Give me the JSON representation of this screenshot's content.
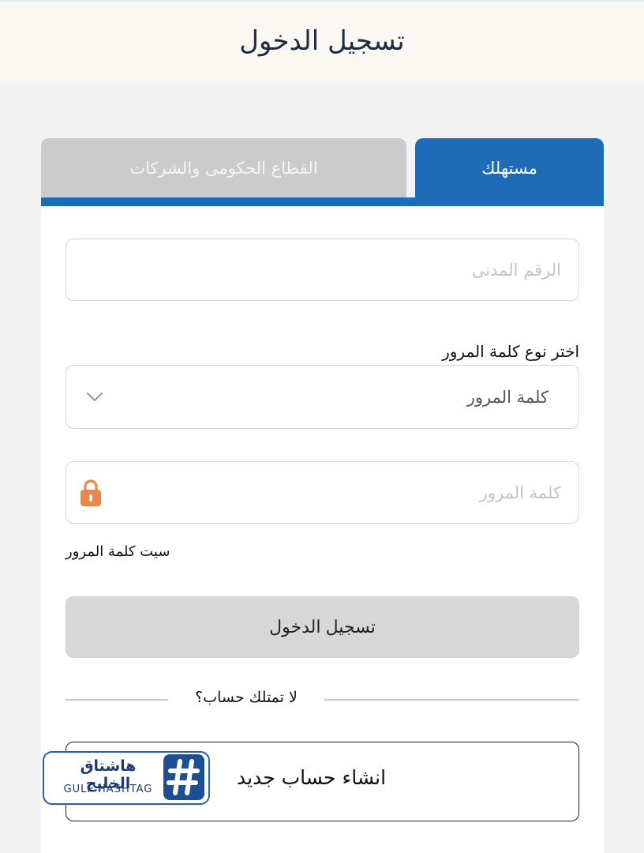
{
  "header": {
    "title": "تسجيل الدخول"
  },
  "tabs": [
    {
      "label": "مستهلك",
      "active": true
    },
    {
      "label": "القطاع الحكومى والشركات",
      "active": false
    }
  ],
  "form": {
    "civil_id_placeholder": "الرقم المدنى",
    "password_type_label": "اختر نوع كلمة المرور",
    "password_type_selected": "كلمة المرور",
    "password_placeholder": "كلمة المرور",
    "forgot_password": "سيت كلمة المرور",
    "login_button": "تسجيل الدخول",
    "no_account_text": "لا تمتلك حساب؟",
    "create_account_button": "انشاء حساب جديد"
  },
  "watermark": {
    "arabic": "هاشتاق الخليج",
    "latin": "GULF HASHTAG"
  },
  "icons": {
    "lock": "lock-icon",
    "dropdown": "chevron-down-icon",
    "watermark_hash": "hash-icon"
  },
  "colors": {
    "primary": "#1e6bb8",
    "tab_inactive": "#cbcbcb",
    "header_bg": "#fbf7f2",
    "page_bg": "#f2f2f2",
    "lock": "#e8894c",
    "button_disabled": "#d7d7d7",
    "watermark_blue": "#1e4f92"
  }
}
